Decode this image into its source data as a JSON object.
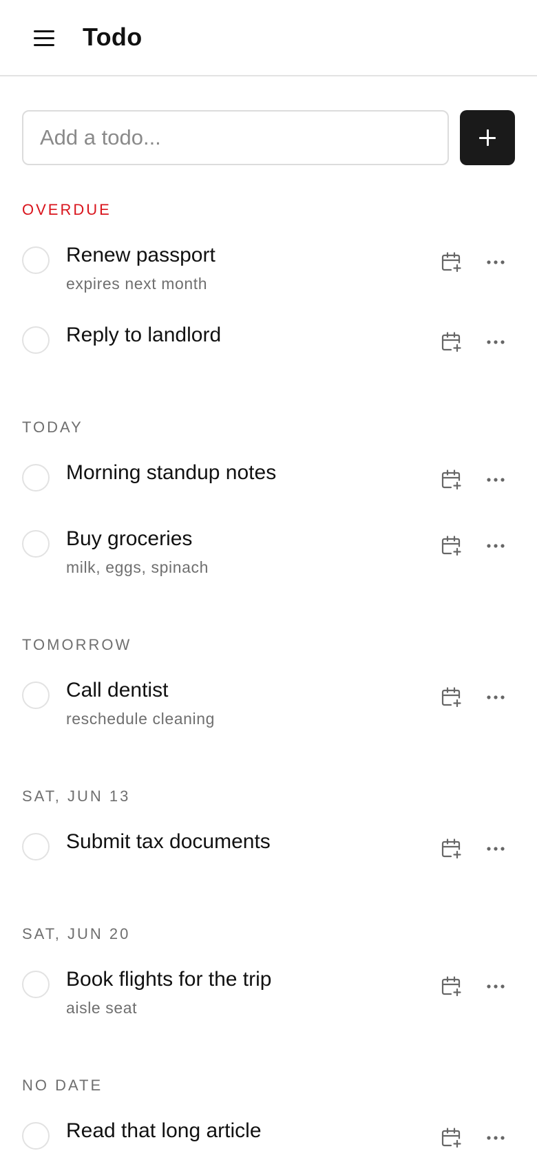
{
  "header": {
    "menu_icon": "hamburger-menu-icon",
    "title": "Todo"
  },
  "add": {
    "placeholder": "Add a todo...",
    "value": "",
    "button_icon": "plus-icon"
  },
  "colors": {
    "overdue": "#d9141c",
    "section": "#6f6f6f",
    "add_button": "#1a1a1a"
  },
  "sections": [
    {
      "label": "OVERDUE",
      "items": [
        {
          "title": "Renew passport",
          "note": "expires next month"
        },
        {
          "title": "Reply to landlord",
          "note": ""
        }
      ]
    },
    {
      "label": "TODAY",
      "items": [
        {
          "title": "Morning standup notes",
          "note": ""
        },
        {
          "title": "Buy groceries",
          "note": "milk, eggs, spinach"
        }
      ]
    },
    {
      "label": "TOMORROW",
      "items": [
        {
          "title": "Call dentist",
          "note": "reschedule cleaning"
        }
      ]
    },
    {
      "label": "SAT, JUN 13",
      "items": [
        {
          "title": "Submit tax documents",
          "note": ""
        }
      ]
    },
    {
      "label": "SAT, JUN 20",
      "items": [
        {
          "title": "Book flights for the trip",
          "note": "aisle seat"
        }
      ]
    },
    {
      "label": "NO DATE",
      "items": [
        {
          "title": "Read that long article",
          "note": ""
        }
      ]
    }
  ],
  "item_icons": {
    "schedule": "calendar-plus-icon",
    "more": "more-horizontal-icon"
  }
}
